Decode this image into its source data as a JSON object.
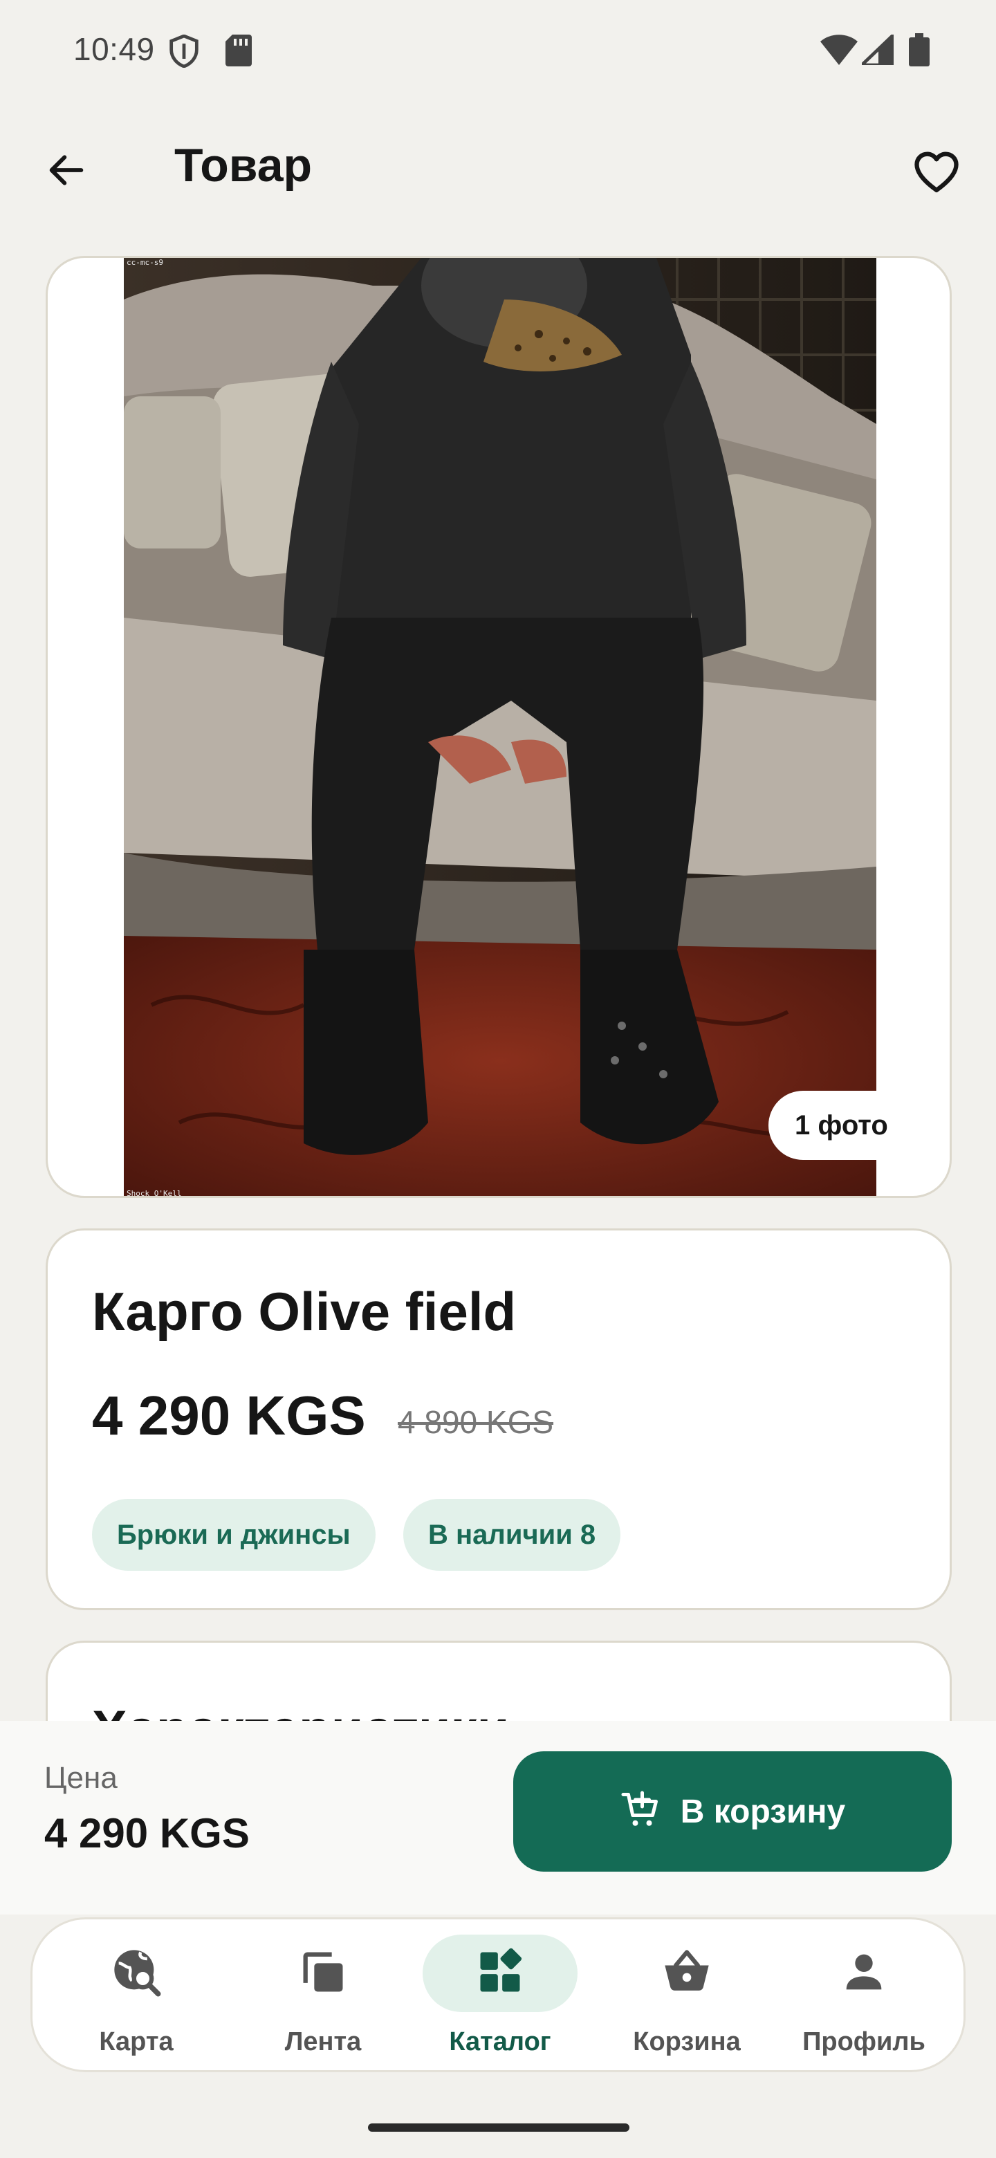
{
  "status_bar": {
    "time": "10:49",
    "icons": [
      "shield-icon",
      "sd-card-icon",
      "wifi-icon",
      "signal-icon",
      "battery-icon"
    ]
  },
  "header": {
    "title": "Товар",
    "back_icon": "arrow-left-icon",
    "favorite_icon": "heart-outline-icon"
  },
  "product": {
    "photo_count": "1 фото",
    "photo_caption_top": "cc-mc-s9",
    "photo_caption_bottom": "Shock Q'Kell",
    "name": "Карго Olive field",
    "price": "4 290 KGS",
    "old_price": "4 890 KGS",
    "category": "Брюки и джинсы",
    "stock": "В наличии 8"
  },
  "specs": {
    "title": "Характеристики"
  },
  "purchase_bar": {
    "price_label": "Цена",
    "price": "4 290 KGS",
    "cart_button_label": "В корзину",
    "cart_icon": "cart-add-icon"
  },
  "nav": {
    "items": [
      {
        "label": "Карта",
        "icon": "map-search-icon",
        "active": false
      },
      {
        "label": "Лента",
        "icon": "feed-stack-icon",
        "active": false
      },
      {
        "label": "Каталог",
        "icon": "catalog-grid-icon",
        "active": true
      },
      {
        "label": "Корзина",
        "icon": "basket-icon",
        "active": false
      },
      {
        "label": "Профиль",
        "icon": "person-icon",
        "active": false
      }
    ]
  },
  "colors": {
    "background": "#f2f1ed",
    "accent": "#146b55",
    "chip_background": "#e2f1ea",
    "chip_text": "#1a6a55",
    "card_border": "#dcd8cc"
  }
}
